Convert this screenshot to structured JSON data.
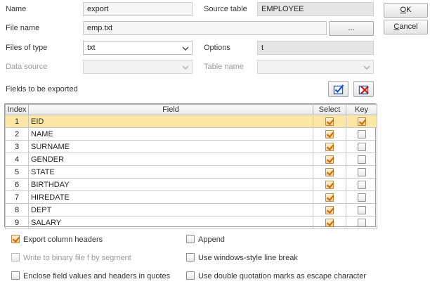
{
  "form": {
    "name_label": "Name",
    "name_value": "export",
    "source_table_label": "Source table",
    "source_table_value": "EMPLOYEE",
    "file_name_label": "File name",
    "file_name_value": "emp.txt",
    "browse_label": "...",
    "files_of_type_label": "Files of type",
    "files_of_type_value": "txt",
    "options_label": "Options",
    "options_value": "t",
    "data_source_label": "Data source",
    "data_source_value": "",
    "table_name_label": "Table name",
    "table_name_value": "",
    "fields_to_export_label": "Fields to be exported"
  },
  "buttons": {
    "ok_label": "OK",
    "ok_mnemonic": "O",
    "ok_rest": "K",
    "cancel_mnemonic": "C",
    "cancel_rest": "ancel",
    "select_all_icon": "select-all-check-icon",
    "deselect_all_icon": "deselect-all-x-icon"
  },
  "grid": {
    "columns": [
      "Index",
      "Field",
      "Select",
      "Key"
    ],
    "rows": [
      {
        "index": "1",
        "field": "EID",
        "select": true,
        "key": true
      },
      {
        "index": "2",
        "field": "NAME",
        "select": true,
        "key": false
      },
      {
        "index": "3",
        "field": "SURNAME",
        "select": true,
        "key": false
      },
      {
        "index": "4",
        "field": "GENDER",
        "select": true,
        "key": false
      },
      {
        "index": "5",
        "field": "STATE",
        "select": true,
        "key": false
      },
      {
        "index": "6",
        "field": "BIRTHDAY",
        "select": true,
        "key": false
      },
      {
        "index": "7",
        "field": "HIREDATE",
        "select": true,
        "key": false
      },
      {
        "index": "8",
        "field": "DEPT",
        "select": true,
        "key": false
      },
      {
        "index": "9",
        "field": "SALARY",
        "select": true,
        "key": false
      }
    ],
    "selected_row": 0
  },
  "options": {
    "export_headers": {
      "label": "Export column headers",
      "checked": true
    },
    "append": {
      "label": "Append",
      "checked": false
    },
    "binary_segment": {
      "label": "Write to binary file f by segment",
      "checked": false
    },
    "windows_linebreak": {
      "label": "Use windows-style line break",
      "checked": false
    },
    "enclose_quotes": {
      "label": "Enclose field values and headers in quotes",
      "checked": false
    },
    "double_quote_escape": {
      "label": "Use double quotation marks as escape character",
      "checked": false
    }
  },
  "colors": {
    "selected_row": "#fde7a6",
    "check_mark": "#c36a00"
  }
}
